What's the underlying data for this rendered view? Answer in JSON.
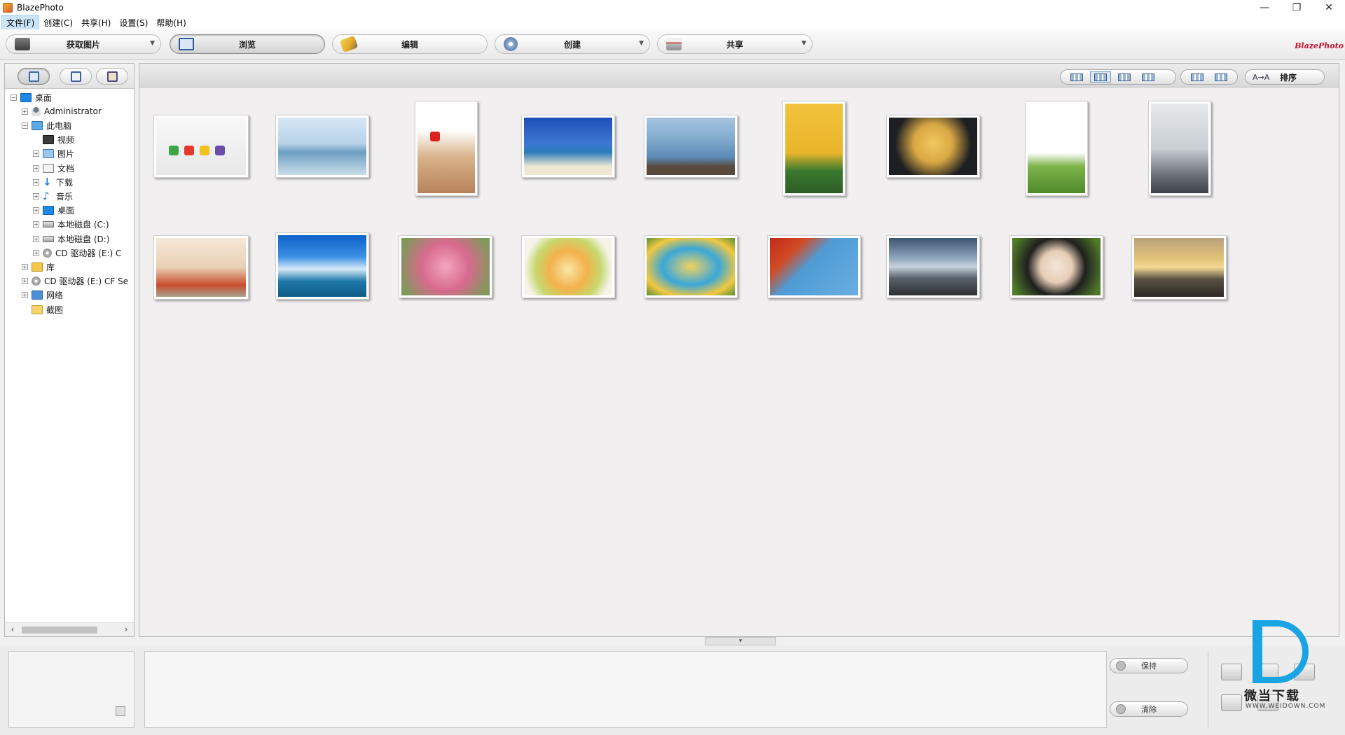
{
  "window": {
    "title": "BlazePhoto",
    "controls": [
      "—",
      "❐",
      "✕"
    ]
  },
  "menu": [
    {
      "label": "文件(F)",
      "active": true
    },
    {
      "label": "创建(C)"
    },
    {
      "label": "共享(H)"
    },
    {
      "label": "设置(S)"
    },
    {
      "label": "帮助(H)"
    }
  ],
  "toolbar": {
    "buttons": [
      {
        "label": "获取图片",
        "icon": "camera-icon",
        "dropdown": true
      },
      {
        "label": "浏览",
        "icon": "browse-icon",
        "selected": true
      },
      {
        "label": "编辑",
        "icon": "edit-icon"
      },
      {
        "label": "创建",
        "icon": "create-icon",
        "dropdown": true
      },
      {
        "label": "共享",
        "icon": "printer-icon",
        "dropdown": true
      }
    ],
    "logo": "BlazePhoto"
  },
  "left_tabs": [
    {
      "name": "folders-tab",
      "selected": true
    },
    {
      "name": "calendar-tab"
    },
    {
      "name": "album-tab"
    }
  ],
  "tree": [
    {
      "label": "桌面",
      "level": 0,
      "exp": "−",
      "icon": "desktop"
    },
    {
      "label": "Administrator",
      "level": 1,
      "exp": "+",
      "icon": "user"
    },
    {
      "label": "此电脑",
      "level": 1,
      "exp": "−",
      "icon": "pc"
    },
    {
      "label": "视频",
      "level": 2,
      "exp": "",
      "icon": "video"
    },
    {
      "label": "图片",
      "level": 2,
      "exp": "+",
      "icon": "pics"
    },
    {
      "label": "文档",
      "level": 2,
      "exp": "+",
      "icon": "docs"
    },
    {
      "label": "下载",
      "level": 2,
      "exp": "+",
      "icon": "down"
    },
    {
      "label": "音乐",
      "level": 2,
      "exp": "+",
      "icon": "music"
    },
    {
      "label": "桌面",
      "level": 2,
      "exp": "+",
      "icon": "desktop"
    },
    {
      "label": "本地磁盘 (C:)",
      "level": 2,
      "exp": "+",
      "icon": "drive"
    },
    {
      "label": "本地磁盘 (D:)",
      "level": 2,
      "exp": "+",
      "icon": "drive"
    },
    {
      "label": "CD 驱动器 (E:) C",
      "level": 2,
      "exp": "+",
      "icon": "cd"
    },
    {
      "label": "库",
      "level": 1,
      "exp": "+",
      "icon": "lib"
    },
    {
      "label": "CD 驱动器 (E:) CF Se",
      "level": 1,
      "exp": "+",
      "icon": "cd"
    },
    {
      "label": "网络",
      "level": 1,
      "exp": "+",
      "icon": "net"
    },
    {
      "label": "截图",
      "level": 1,
      "exp": "",
      "icon": "folder"
    }
  ],
  "scrollbar": {
    "left": "‹",
    "right": "›"
  },
  "view_modes": [
    "slideshow-view-icon",
    "large-grid-view-icon",
    "small-grid-view-icon",
    "list-view-icon"
  ],
  "view_modes2": [
    "single-view-icon",
    "filmstrip-view-icon"
  ],
  "view_selected": 1,
  "sort": {
    "label": "排序",
    "icon": "A→A"
  },
  "collapse_glyph": "▾",
  "thumbnails": [
    {
      "name": "dice",
      "bg": "linear-gradient(#f8f8f8,#e8e8e8)",
      "accents": [
        "#3aa845",
        "#e23b2e",
        "#f2c11d",
        "#6a4fa8"
      ]
    },
    {
      "name": "bridge-sea",
      "bg": "linear-gradient(#d5e6f4 0%,#b9d3ea 45%,#6d9fc2 60%,#c9dde9 100%)",
      "accents": []
    },
    {
      "name": "santa-hat-child",
      "bg": "linear-gradient(#fefefe 0%,#fefefe 30%,#d9b28a 60%,#b7825a 100%)",
      "accents": [
        "#d8231f"
      ]
    },
    {
      "name": "tropical-bay",
      "bg": "linear-gradient(#1f4fb8 0%,#3d77d3 45%,#2a7ab9 60%,#ede7d4 85%)",
      "accents": []
    },
    {
      "name": "boat-people",
      "bg": "linear-gradient(#a7c5e1 0%,#7fa8cc 40%,#5a89b3 70%,#5a4a3c 85%)",
      "accents": []
    },
    {
      "name": "yellow-balloons",
      "bg": "linear-gradient(#f2c33c 0%,#eab52b 55%,#3a7a2f 75%,#2d5d25 100%)",
      "accents": []
    },
    {
      "name": "sunflower-hat",
      "bg": "radial-gradient(circle at 50% 45%,#f1c85f 0%,#d9a843 35%,#1d1f23 70%)",
      "accents": []
    },
    {
      "name": "tree-meadow",
      "bg": "linear-gradient(#ffffff 0%,#ffffff 55%,#7fb34a 70%,#4e8b2a 100%)",
      "accents": []
    },
    {
      "name": "twin-towers",
      "bg": "linear-gradient(#e6e9ec 0%,#c9cfd4 50%,#6a7077 80%,#3c4148 100%)",
      "accents": []
    },
    {
      "name": "teddy-bear",
      "bg": "linear-gradient(#f6e8d8 0%,#e9d0b4 50%,#c84d2e 80%,#a9a18f 100%)",
      "accents": []
    },
    {
      "name": "blue-sky-sea",
      "bg": "linear-gradient(#0e62c9 0%,#3a8fe4 35%,#d7e9f7 55%,#1d78a9 75%,#0f5b86 100%)",
      "accents": []
    },
    {
      "name": "pink-flowers",
      "bg": "radial-gradient(circle at 50% 50%,#f2a6bf 0%,#d86a8e 45%,#7e9a5a 90%)",
      "accents": []
    },
    {
      "name": "fruit-plate",
      "bg": "radial-gradient(circle at 50% 55%,#f8e7a6 0%,#f3b14b 35%,#c6d86d 60%,#f5f3ea 80%)",
      "accents": []
    },
    {
      "name": "pool-boy",
      "bg": "radial-gradient(ellipse at 50% 50%,#f4d25e 0%,#3aa7d9 45%,#f2c840 75%,#5a8e37 100%)",
      "accents": []
    },
    {
      "name": "red-leaves",
      "bg": "linear-gradient(135deg,#c02a1a 0%,#d24a25 25%,#4f9cd6 45%,#6aaee0 100%)",
      "accents": []
    },
    {
      "name": "cloudy-beach",
      "bg": "linear-gradient(#3c5473 0%,#8fa4bd 35%,#c8d2de 50%,#59626b 70%,#2e3136 100%)",
      "accents": []
    },
    {
      "name": "painted-face-girl",
      "bg": "radial-gradient(circle at 50% 50%,#f3e6d9 0%,#e8cdb6 30%,#1f1f1f 55%,#4f7a2a 90%)",
      "accents": []
    },
    {
      "name": "sunset-coast",
      "bg": "linear-gradient(#b8a07a 0%,#e3c37a 35%,#f4d892 50%,#5a5143 70%,#2b2823 100%)",
      "accents": []
    }
  ],
  "tray": {
    "hold_label": "保持",
    "clear_label": "清除"
  },
  "watermark": {
    "text": "微当下载",
    "url": "WWW.WEIDOWN.COM"
  }
}
